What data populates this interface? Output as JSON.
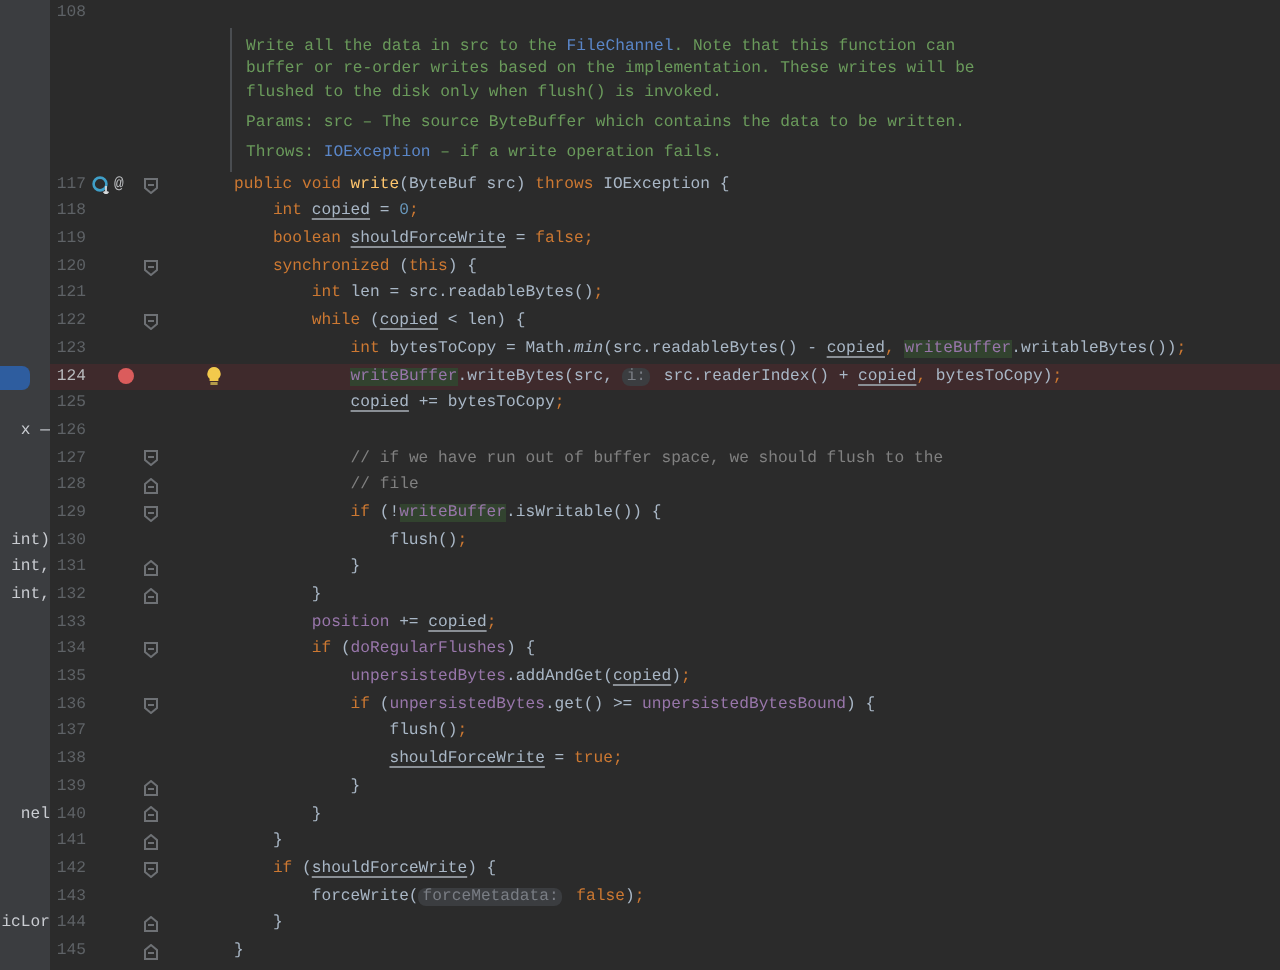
{
  "lines": [
    {
      "kind": "code",
      "number": "108"
    },
    {
      "kind": "doc",
      "summary": {
        "before": "Write all the data in src to the ",
        "link": "FileChannel",
        "after": ". Note that this function can buffer or re-order writes based on the implementation. These writes will be flushed to the disk only when flush() is invoked."
      },
      "params": "Params: src – The source ByteBuffer which contains the data to be written.",
      "throws": {
        "label": "Throws: ",
        "link": "IOException",
        "after": " – if a write operation fails."
      }
    },
    {
      "kind": "code",
      "number": "117",
      "override_marker": true,
      "annotation_glyph": "@",
      "fold_start": true,
      "tokens": [
        {
          "kind": "kw",
          "text": "public void "
        },
        {
          "kind": "method",
          "text": "write"
        },
        {
          "kind": "plain",
          "text": "(ByteBuf src) "
        },
        {
          "kind": "kw",
          "text": "throws "
        },
        {
          "kind": "plain",
          "text": "IOException {"
        }
      ]
    },
    {
      "kind": "code",
      "number": "118",
      "tokens": [
        {
          "kind": "kw",
          "text": "    int "
        },
        {
          "kind": "var",
          "text": "copied"
        },
        {
          "kind": "plain",
          "text": " = "
        },
        {
          "kind": "num",
          "text": "0"
        },
        {
          "kind": "punct",
          "text": ";"
        }
      ]
    },
    {
      "kind": "code",
      "number": "119",
      "tokens": [
        {
          "kind": "kw",
          "text": "    boolean "
        },
        {
          "kind": "var",
          "text": "shouldForceWrite"
        },
        {
          "kind": "plain",
          "text": " = "
        },
        {
          "kind": "kw",
          "text": "false"
        },
        {
          "kind": "punct",
          "text": ";"
        }
      ]
    },
    {
      "kind": "code",
      "number": "120",
      "fold_start": true,
      "tokens": [
        {
          "kind": "kw",
          "text": "    synchronized "
        },
        {
          "kind": "plain",
          "text": "("
        },
        {
          "kind": "kw",
          "text": "this"
        },
        {
          "kind": "plain",
          "text": ") {"
        }
      ]
    },
    {
      "kind": "code",
      "number": "121",
      "tokens": [
        {
          "kind": "kw",
          "text": "        int "
        },
        {
          "kind": "plain",
          "text": "len = src.readableBytes()"
        },
        {
          "kind": "punct",
          "text": ";"
        }
      ]
    },
    {
      "kind": "code",
      "number": "122",
      "fold_start": true,
      "tokens": [
        {
          "kind": "kw",
          "text": "        while "
        },
        {
          "kind": "plain",
          "text": "("
        },
        {
          "kind": "var",
          "text": "copied"
        },
        {
          "kind": "plain",
          "text": " < len) {"
        }
      ]
    },
    {
      "kind": "code",
      "number": "123",
      "tokens": [
        {
          "kind": "kw",
          "text": "            int "
        },
        {
          "kind": "plain",
          "text": "bytesToCopy = Math."
        },
        {
          "kind": "static",
          "text": "min"
        },
        {
          "kind": "plain",
          "text": "(src.readableBytes() - "
        },
        {
          "kind": "var",
          "text": "copied"
        },
        {
          "kind": "punct",
          "text": ", "
        },
        {
          "kind": "hl",
          "text": "writeBuffer"
        },
        {
          "kind": "plain",
          "text": ".writableBytes())"
        },
        {
          "kind": "punct",
          "text": ";"
        }
      ]
    },
    {
      "kind": "code",
      "number": "124",
      "breakpoint": true,
      "intention_bulb": true,
      "side": {
        "selected": true
      },
      "tokens": [
        {
          "kind": "hl",
          "text": "            writeBuffer"
        },
        {
          "kind": "plain",
          "text": ".writeBytes(src, "
        },
        {
          "kind": "hint",
          "text": "i:"
        },
        {
          "kind": "plain",
          "text": " src.readerIndex() + "
        },
        {
          "kind": "var",
          "text": "copied"
        },
        {
          "kind": "punct",
          "text": ", "
        },
        {
          "kind": "plain",
          "text": "bytesToCopy)"
        },
        {
          "kind": "punct",
          "text": ";"
        }
      ]
    },
    {
      "kind": "code",
      "number": "125",
      "tokens": [
        {
          "kind": "var",
          "text": "            copied"
        },
        {
          "kind": "plain",
          "text": " += bytesToCopy"
        },
        {
          "kind": "punct",
          "text": ";"
        }
      ]
    },
    {
      "kind": "code",
      "number": "126",
      "side": {
        "text": "x —",
        "selected": false
      }
    },
    {
      "kind": "code",
      "number": "127",
      "fold_start": true,
      "tokens": [
        {
          "kind": "comment",
          "text": "            // if we have run out of buffer space, we should flush to the"
        }
      ]
    },
    {
      "kind": "code",
      "number": "128",
      "fold_end": true,
      "tokens": [
        {
          "kind": "comment",
          "text": "            // file"
        }
      ]
    },
    {
      "kind": "code",
      "number": "129",
      "fold_start": true,
      "tokens": [
        {
          "kind": "kw",
          "text": "            if "
        },
        {
          "kind": "plain",
          "text": "(!"
        },
        {
          "kind": "hl",
          "text": "writeBuffer"
        },
        {
          "kind": "plain",
          "text": ".isWritable()) {"
        }
      ]
    },
    {
      "kind": "code",
      "number": "130",
      "side": {
        "text": "int)",
        "selected": false
      },
      "tokens": [
        {
          "kind": "plain",
          "text": "                flush()"
        },
        {
          "kind": "punct",
          "text": ";"
        }
      ]
    },
    {
      "kind": "code",
      "number": "131",
      "side": {
        "text": "int,",
        "selected": false
      },
      "fold_end": true,
      "tokens": [
        {
          "kind": "plain",
          "text": "            }"
        }
      ]
    },
    {
      "kind": "code",
      "number": "132",
      "side": {
        "text": "int,",
        "selected": false
      },
      "fold_end": true,
      "tokens": [
        {
          "kind": "plain",
          "text": "        }"
        }
      ]
    },
    {
      "kind": "code",
      "number": "133",
      "tokens": [
        {
          "kind": "field",
          "text": "        position"
        },
        {
          "kind": "plain",
          "text": " += "
        },
        {
          "kind": "var",
          "text": "copied"
        },
        {
          "kind": "punct",
          "text": ";"
        }
      ]
    },
    {
      "kind": "code",
      "number": "134",
      "fold_start": true,
      "tokens": [
        {
          "kind": "kw",
          "text": "        if "
        },
        {
          "kind": "plain",
          "text": "("
        },
        {
          "kind": "field",
          "text": "doRegularFlushes"
        },
        {
          "kind": "plain",
          "text": ") {"
        }
      ]
    },
    {
      "kind": "code",
      "number": "135",
      "tokens": [
        {
          "kind": "field",
          "text": "            unpersistedBytes"
        },
        {
          "kind": "plain",
          "text": ".addAndGet("
        },
        {
          "kind": "var",
          "text": "copied"
        },
        {
          "kind": "plain",
          "text": ")"
        },
        {
          "kind": "punct",
          "text": ";"
        }
      ]
    },
    {
      "kind": "code",
      "number": "136",
      "fold_start": true,
      "tokens": [
        {
          "kind": "kw",
          "text": "            if "
        },
        {
          "kind": "plain",
          "text": "("
        },
        {
          "kind": "field",
          "text": "unpersistedBytes"
        },
        {
          "kind": "plain",
          "text": ".get() >= "
        },
        {
          "kind": "field",
          "text": "unpersistedBytesBound"
        },
        {
          "kind": "plain",
          "text": ") {"
        }
      ]
    },
    {
      "kind": "code",
      "number": "137",
      "tokens": [
        {
          "kind": "plain",
          "text": "                flush()"
        },
        {
          "kind": "punct",
          "text": ";"
        }
      ]
    },
    {
      "kind": "code",
      "number": "138",
      "tokens": [
        {
          "kind": "var",
          "text": "                shouldForceWrite"
        },
        {
          "kind": "plain",
          "text": " = "
        },
        {
          "kind": "kw",
          "text": "true"
        },
        {
          "kind": "punct",
          "text": ";"
        }
      ]
    },
    {
      "kind": "code",
      "number": "139",
      "fold_end": true,
      "tokens": [
        {
          "kind": "plain",
          "text": "            }"
        }
      ]
    },
    {
      "kind": "code",
      "number": "140",
      "side": {
        "text": "nel",
        "selected": false
      },
      "fold_end": true,
      "tokens": [
        {
          "kind": "plain",
          "text": "        }"
        }
      ]
    },
    {
      "kind": "code",
      "number": "141",
      "fold_end": true,
      "tokens": [
        {
          "kind": "plain",
          "text": "    }"
        }
      ]
    },
    {
      "kind": "code",
      "number": "142",
      "fold_start": true,
      "tokens": [
        {
          "kind": "kw",
          "text": "    if "
        },
        {
          "kind": "plain",
          "text": "("
        },
        {
          "kind": "var",
          "text": "shouldForceWrite"
        },
        {
          "kind": "plain",
          "text": ") {"
        }
      ]
    },
    {
      "kind": "code",
      "number": "143",
      "tokens": [
        {
          "kind": "plain",
          "text": "        forceWrite("
        },
        {
          "kind": "hint",
          "text": "forceMetadata:"
        },
        {
          "kind": "kw",
          "text": " false"
        },
        {
          "kind": "plain",
          "text": ")"
        },
        {
          "kind": "punct",
          "text": ";"
        }
      ]
    },
    {
      "kind": "code",
      "number": "144",
      "side": {
        "text": "icLor",
        "selected": false
      },
      "fold_end": true,
      "tokens": [
        {
          "kind": "plain",
          "text": "    }"
        }
      ]
    },
    {
      "kind": "code",
      "number": "145",
      "fold_end": true,
      "tokens": [
        {
          "kind": "plain",
          "text": "}"
        }
      ]
    }
  ]
}
